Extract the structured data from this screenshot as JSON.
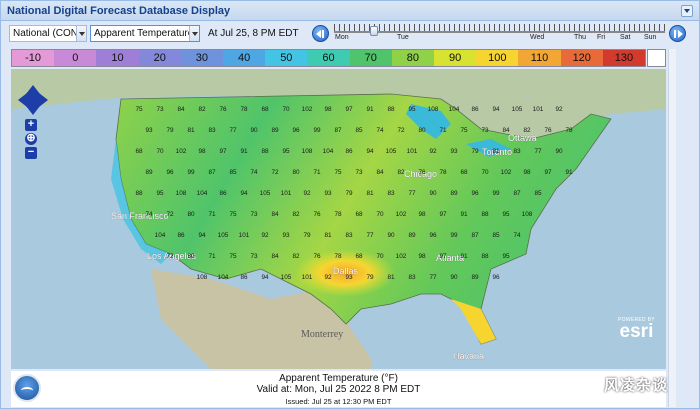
{
  "window": {
    "title": "National Digital Forecast Database Display"
  },
  "toolbar": {
    "region": "National (CONUS)",
    "variable": "Apparent Temperature (°F)",
    "valid_time": "At Jul 25,   8 PM EDT"
  },
  "timeline": {
    "days": [
      "Mon",
      "Tue",
      "Wed",
      "Thu",
      "Fri",
      "Sat",
      "Sun"
    ],
    "position": 0.12
  },
  "legend": {
    "values": [
      "-10",
      "0",
      "10",
      "20",
      "30",
      "40",
      "50",
      "60",
      "70",
      "80",
      "90",
      "100",
      "110",
      "120",
      "130"
    ],
    "colors": [
      "#e59ad8",
      "#c88ad6",
      "#9f7ed8",
      "#8488db",
      "#6f92dd",
      "#4ea6e3",
      "#44c4e4",
      "#3ecbb1",
      "#50c46a",
      "#8fd24a",
      "#d8e231",
      "#f7d531",
      "#f2a633",
      "#e86a38",
      "#d23a2e"
    ]
  },
  "map": {
    "cities": [
      {
        "name": "Ottawa"
      },
      {
        "name": "Toronto"
      },
      {
        "name": "Chicago"
      },
      {
        "name": "San Francisco"
      },
      {
        "name": "Los Angeles"
      },
      {
        "name": "Dallas"
      },
      {
        "name": "Atlanta"
      },
      {
        "name": "Havana"
      }
    ],
    "places": [
      {
        "name": "Monterrey"
      }
    ],
    "points": [
      {
        "v": "75",
        "c": "green"
      },
      {
        "v": "73",
        "c": "green"
      },
      {
        "v": "84",
        "c": "yellowgreen"
      },
      {
        "v": "82",
        "c": "yellowgreen"
      },
      {
        "v": "76",
        "c": "green"
      },
      {
        "v": "78",
        "c": "green"
      },
      {
        "v": "68",
        "c": "green"
      },
      {
        "v": "70",
        "c": "green"
      },
      {
        "v": "102",
        "c": "orange"
      },
      {
        "v": "98",
        "c": "yellow"
      },
      {
        "v": "97",
        "c": "yellow"
      },
      {
        "v": "91",
        "c": "yellow"
      },
      {
        "v": "88",
        "c": "yellowgreen"
      },
      {
        "v": "95",
        "c": "yellow"
      },
      {
        "v": "108",
        "c": "orange"
      },
      {
        "v": "104",
        "c": "orange"
      },
      {
        "v": "86",
        "c": "yellowgreen"
      },
      {
        "v": "94",
        "c": "yellow"
      },
      {
        "v": "105",
        "c": "orange"
      },
      {
        "v": "101",
        "c": "orange"
      },
      {
        "v": "92",
        "c": "yellow"
      },
      {
        "v": "93",
        "c": "yellow"
      },
      {
        "v": "79",
        "c": "green"
      },
      {
        "v": "81",
        "c": "yellowgreen"
      },
      {
        "v": "83",
        "c": "yellowgreen"
      },
      {
        "v": "77",
        "c": "green"
      },
      {
        "v": "90",
        "c": "yellow"
      },
      {
        "v": "89",
        "c": "yellowgreen"
      },
      {
        "v": "96",
        "c": "yellow"
      },
      {
        "v": "99",
        "c": "yellow"
      },
      {
        "v": "87",
        "c": "yellowgreen"
      },
      {
        "v": "85",
        "c": "yellowgreen"
      },
      {
        "v": "74",
        "c": "green"
      },
      {
        "v": "72",
        "c": "green"
      },
      {
        "v": "80",
        "c": "green"
      },
      {
        "v": "71",
        "c": "green"
      }
    ]
  },
  "branding": {
    "powered_by": "POWERED BY",
    "esri": "esri",
    "watermark": "风凌杂谈"
  },
  "footer": {
    "variable": "Apparent Temperature (°F)",
    "valid": "Valid at:  Mon, Jul 25 2022    8 PM EDT",
    "issued": "Issued: Jul 25 at 12:30 PM EDT"
  }
}
